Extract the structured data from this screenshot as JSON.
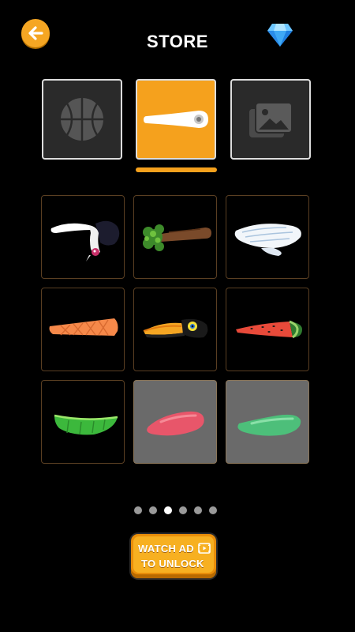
{
  "header": {
    "title": "STORE"
  },
  "colors": {
    "accent": "#f5a11d",
    "button_orange": "#f7b021",
    "locked_cell": "#6a6a6a",
    "gem_blue": "#3fa9f5"
  },
  "category_tabs": [
    {
      "icon": "basketball-icon",
      "active": false
    },
    {
      "icon": "flipper-icon",
      "active": true
    },
    {
      "icon": "image-gallery-icon",
      "active": false
    }
  ],
  "items": [
    {
      "icon": "vulture-flipper-icon",
      "locked": false
    },
    {
      "icon": "leafy-branch-flipper-icon",
      "locked": false
    },
    {
      "icon": "wing-flipper-icon",
      "locked": false
    },
    {
      "icon": "ice-cream-cone-flipper-icon",
      "locked": false
    },
    {
      "icon": "toucan-flipper-icon",
      "locked": false
    },
    {
      "icon": "watermelon-flipper-icon",
      "locked": false
    },
    {
      "icon": "leaf-flipper-icon",
      "locked": false
    },
    {
      "icon": "red-blob-flipper-icon",
      "locked": true
    },
    {
      "icon": "green-blob-flipper-icon",
      "locked": true
    }
  ],
  "pagination": {
    "total": 6,
    "current": 3
  },
  "unlock_button": {
    "line1": "WATCH AD",
    "line2": "TO UNLOCK",
    "icon": "film-icon"
  }
}
